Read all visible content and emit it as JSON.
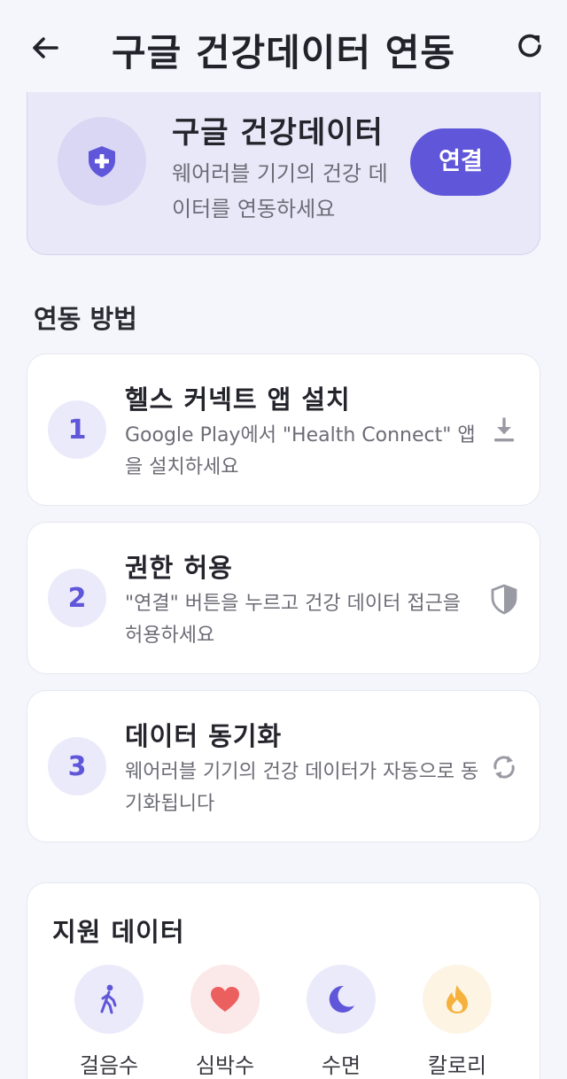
{
  "header": {
    "title": "구글 건강데이터 연동"
  },
  "banner": {
    "title": "구글 건강데이터",
    "description": "웨어러블 기기의 건강 데이터를 연동하세요",
    "connect_label": "연결"
  },
  "steps_section": {
    "title": "연동 방법",
    "steps": [
      {
        "number": "1",
        "title": "헬스 커넥트 앱 설치",
        "description": "Google Play에서 \"Health Connect\" 앱을 설치하세요",
        "icon": "download-icon"
      },
      {
        "number": "2",
        "title": "권한 허용",
        "description": "\"연결\" 버튼을 누르고 건강 데이터 접근을 허용하세요",
        "icon": "shield-icon"
      },
      {
        "number": "3",
        "title": "데이터 동기화",
        "description": "웨어러블 기기의 건강 데이터가 자동으로 동기화됩니다",
        "icon": "sync-icon"
      }
    ]
  },
  "supported": {
    "title": "지원 데이터",
    "items": [
      {
        "label": "걸음수",
        "icon": "walking-icon",
        "color": "#5f56d9",
        "bg": "#ebeafa"
      },
      {
        "label": "심박수",
        "icon": "heart-icon",
        "color": "#ec5f5f",
        "bg": "#fbe8e8"
      },
      {
        "label": "수면",
        "icon": "moon-icon",
        "color": "#5f56d9",
        "bg": "#ebeafa"
      },
      {
        "label": "칼로리",
        "icon": "flame-icon",
        "color": "#f6b13c",
        "bg": "#fdf4e3"
      }
    ]
  },
  "colors": {
    "accent": "#5f56d9",
    "background": "#f5f6fb",
    "banner_bg": "#e9e8f8"
  }
}
